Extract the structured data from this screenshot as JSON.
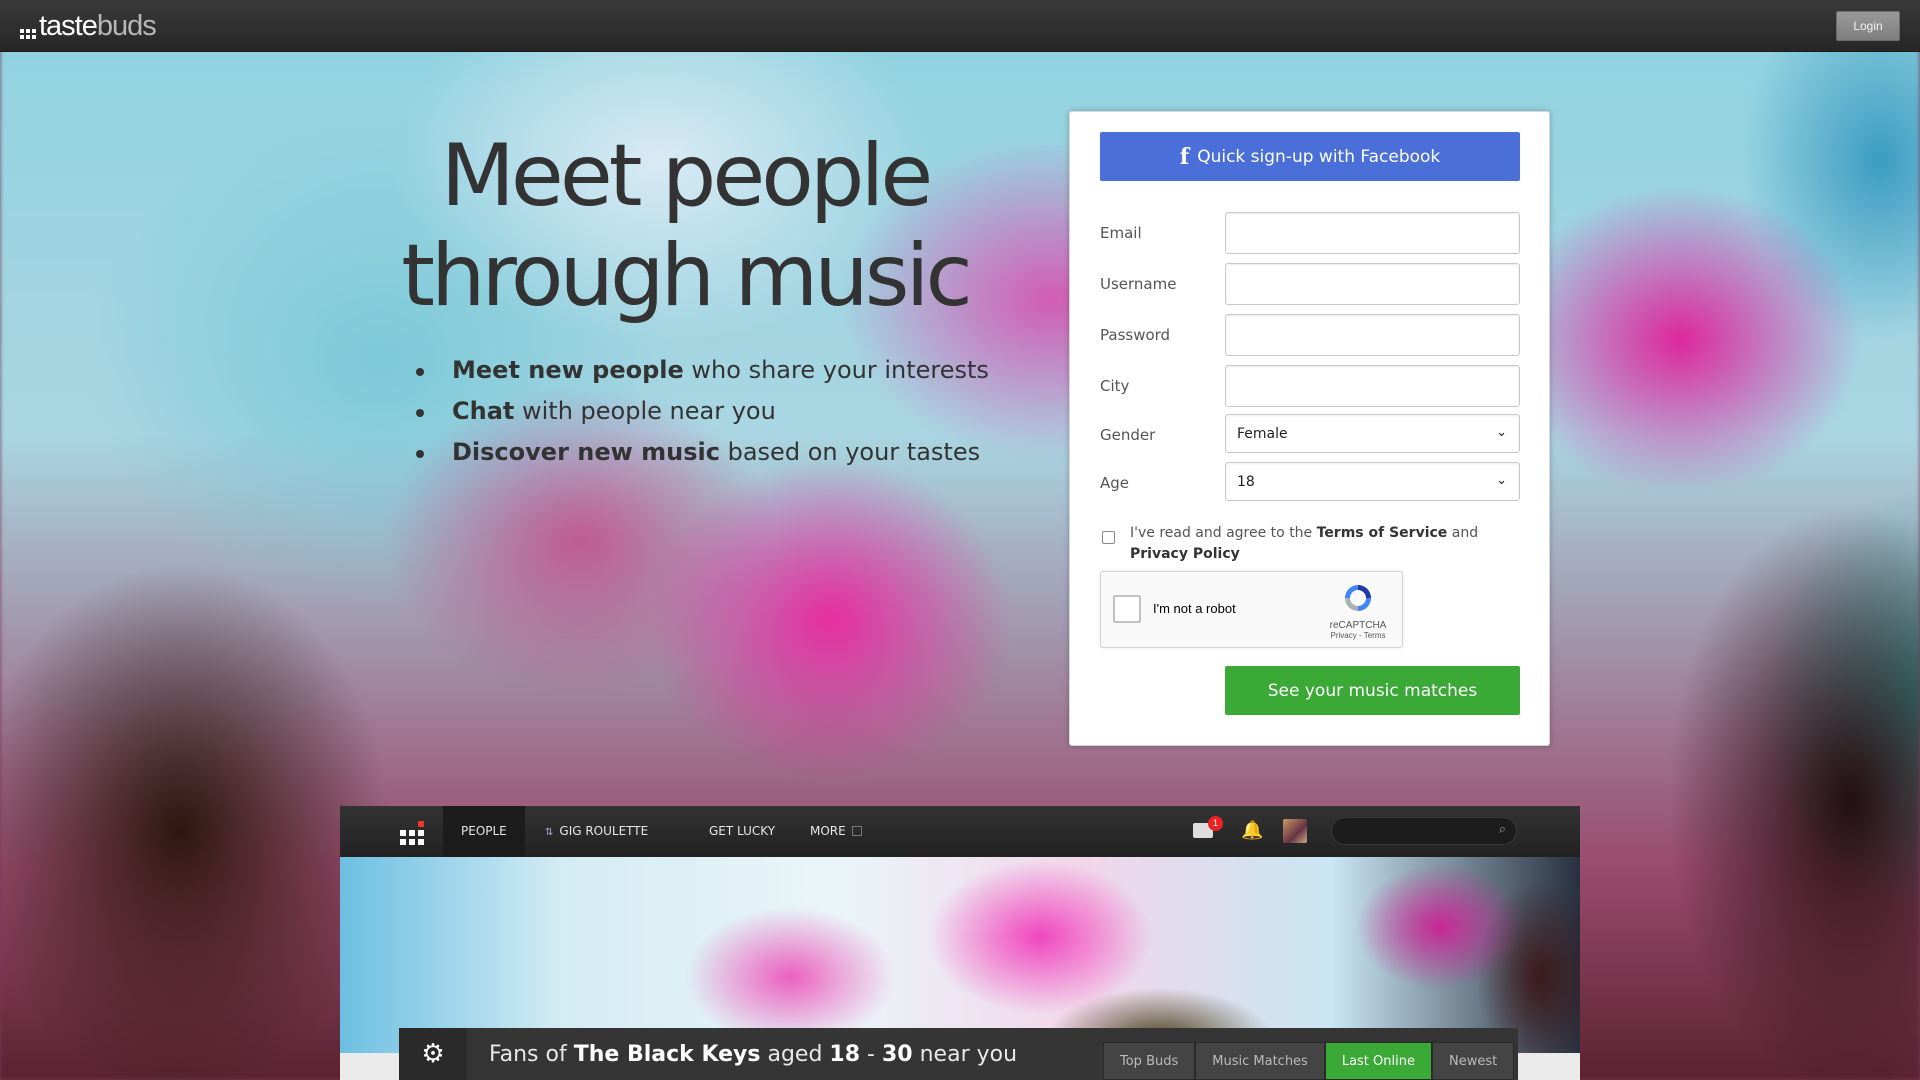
{
  "topbar": {
    "logo_part1": "taste",
    "logo_part2": "buds",
    "login_label": "Login"
  },
  "hero": {
    "title_line1": "Meet people",
    "title_line2": "through music",
    "bullets": [
      {
        "bold": "Meet new people",
        "rest": " who share your interests"
      },
      {
        "bold": "Chat",
        "rest": " with people near you"
      },
      {
        "bold": "Discover new music",
        "rest": " based on your tastes"
      }
    ]
  },
  "signup": {
    "facebook_icon": "f",
    "facebook_label": "Quick sign-up with Facebook",
    "email_label": "Email",
    "username_label": "Username",
    "password_label": "Password",
    "city_label": "City",
    "gender_label": "Gender",
    "gender_value": "Female",
    "age_label": "Age",
    "age_value": "18",
    "agree_prefix": "I've read and agree to the ",
    "terms_label": "Terms of Service",
    "agree_and": " and ",
    "privacy_label": "Privacy Policy",
    "captcha_label": "I'm not a robot",
    "captcha_brand": "reCAPTCHA",
    "captcha_privacy": "Privacy",
    "captcha_sep": " - ",
    "captcha_terms": "Terms",
    "submit_label": "See your music matches",
    "facebook_color": "#4a6fd8",
    "submit_color": "#3aa935"
  },
  "preview": {
    "tabs": {
      "people": "PEOPLE",
      "gig_roulette": "GIG ROULETTE",
      "get_lucky": "GET LUCKY",
      "more": "MORE"
    },
    "mail_badge": "1",
    "fans": {
      "prefix": "Fans of ",
      "artist": "The Black Keys",
      "aged": " aged ",
      "min_age": "18",
      "dash": " - ",
      "max_age": "30",
      "suffix": " near you"
    },
    "filters": [
      "Top Buds",
      "Music Matches",
      "Last Online",
      "Newest"
    ],
    "active_filter": "Last Online"
  }
}
